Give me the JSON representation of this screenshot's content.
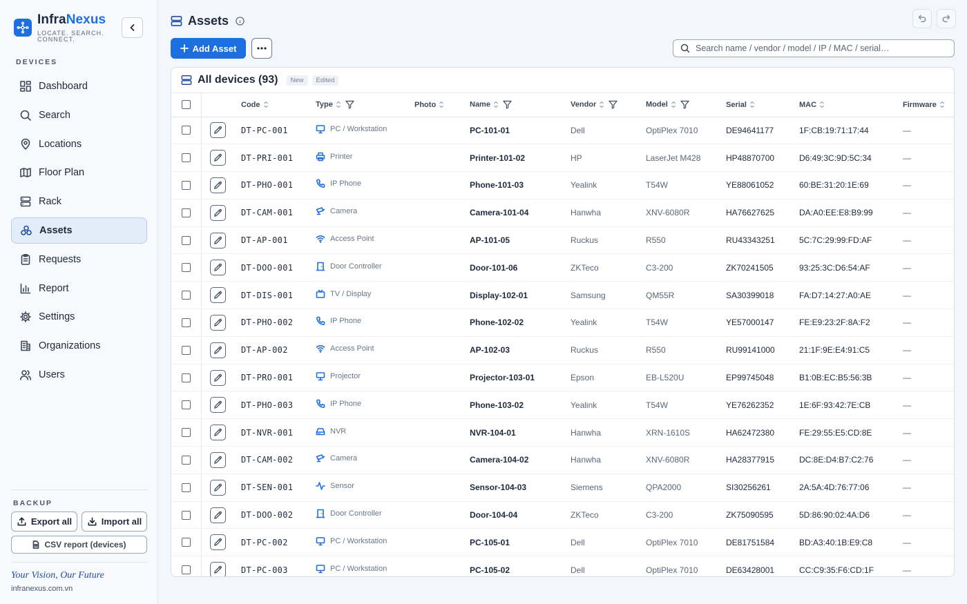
{
  "brand": {
    "name_a": "Infra",
    "name_b": "Nexus",
    "tagline": "LOCATE. SEARCH. CONNECT."
  },
  "sidebar": {
    "section_label": "DEVICES",
    "items": [
      {
        "label": "Dashboard",
        "icon": "dashboard-icon"
      },
      {
        "label": "Search",
        "icon": "search-icon"
      },
      {
        "label": "Locations",
        "icon": "map-pin-icon"
      },
      {
        "label": "Floor Plan",
        "icon": "map-icon"
      },
      {
        "label": "Rack",
        "icon": "server-icon"
      },
      {
        "label": "Assets",
        "icon": "boxes-icon",
        "active": true
      },
      {
        "label": "Requests",
        "icon": "clipboard-icon"
      },
      {
        "label": "Report",
        "icon": "bar-chart-icon"
      },
      {
        "label": "Settings",
        "icon": "gear-icon"
      },
      {
        "label": "Organizations",
        "icon": "building-icon"
      },
      {
        "label": "Users",
        "icon": "users-icon"
      }
    ],
    "backup_label": "BACKUP",
    "export_label": "Export all",
    "import_label": "Import all",
    "csv_label": "CSV report (devices)",
    "slogan": "Your Vision, Our Future",
    "site": "infranexus.com.vn"
  },
  "header": {
    "title": "Assets",
    "add_label": "Add Asset",
    "search_placeholder": "Search name / vendor / model / IP / MAC / serial…"
  },
  "table": {
    "title": "All devices (93)",
    "tag_new": "New",
    "tag_edited": "Edited",
    "columns": {
      "code": "Code",
      "type": "Type",
      "photo": "Photo",
      "name": "Name",
      "vendor": "Vendor",
      "model": "Model",
      "serial": "Serial",
      "mac": "MAC",
      "firmware": "Firmware"
    },
    "rows": [
      {
        "code": "DT-PC-001",
        "type": "PC / Workstation",
        "icon": "monitor-icon",
        "name": "PC-101-01",
        "vendor": "Dell",
        "model": "OptiPlex 7010",
        "serial": "DE94641177",
        "mac": "1F:CB:19:71:17:44",
        "firmware": "—"
      },
      {
        "code": "DT-PRI-001",
        "type": "Printer",
        "icon": "printer-icon",
        "name": "Printer-101-02",
        "vendor": "HP",
        "model": "LaserJet M428",
        "serial": "HP48870700",
        "mac": "D6:49:3C:9D:5C:34",
        "firmware": "—"
      },
      {
        "code": "DT-PHO-001",
        "type": "IP Phone",
        "icon": "phone-icon",
        "name": "Phone-101-03",
        "vendor": "Yealink",
        "model": "T54W",
        "serial": "YE88061052",
        "mac": "60:BE:31:20:1E:69",
        "firmware": "—"
      },
      {
        "code": "DT-CAM-001",
        "type": "Camera",
        "icon": "cctv-icon",
        "name": "Camera-101-04",
        "vendor": "Hanwha",
        "model": "XNV-6080R",
        "serial": "HA76627625",
        "mac": "DA:A0:EE:E8:B9:99",
        "firmware": "—"
      },
      {
        "code": "DT-AP-001",
        "type": "Access Point",
        "icon": "wifi-icon",
        "name": "AP-101-05",
        "vendor": "Ruckus",
        "model": "R550",
        "serial": "RU43343251",
        "mac": "5C:7C:29:99:FD:AF",
        "firmware": "—"
      },
      {
        "code": "DT-DOO-001",
        "type": "Door Controller",
        "icon": "door-icon",
        "name": "Door-101-06",
        "vendor": "ZKTeco",
        "model": "C3-200",
        "serial": "ZK70241505",
        "mac": "93:25:3C:D6:54:AF",
        "firmware": "—"
      },
      {
        "code": "DT-DIS-001",
        "type": "TV / Display",
        "icon": "tv-icon",
        "name": "Display-102-01",
        "vendor": "Samsung",
        "model": "QM55R",
        "serial": "SA30399018",
        "mac": "FA:D7:14:27:A0:AE",
        "firmware": "—"
      },
      {
        "code": "DT-PHO-002",
        "type": "IP Phone",
        "icon": "phone-icon",
        "name": "Phone-102-02",
        "vendor": "Yealink",
        "model": "T54W",
        "serial": "YE57000147",
        "mac": "FE:E9:23:2F:8A:F2",
        "firmware": "—"
      },
      {
        "code": "DT-AP-002",
        "type": "Access Point",
        "icon": "wifi-icon",
        "name": "AP-102-03",
        "vendor": "Ruckus",
        "model": "R550",
        "serial": "RU99141000",
        "mac": "21:1F:9E:E4:91:C5",
        "firmware": "—"
      },
      {
        "code": "DT-PRO-001",
        "type": "Projector",
        "icon": "projector-icon",
        "name": "Projector-103-01",
        "vendor": "Epson",
        "model": "EB-L520U",
        "serial": "EP99745048",
        "mac": "B1:0B:EC:B5:56:3B",
        "firmware": "—"
      },
      {
        "code": "DT-PHO-003",
        "type": "IP Phone",
        "icon": "phone-icon",
        "name": "Phone-103-02",
        "vendor": "Yealink",
        "model": "T54W",
        "serial": "YE76262352",
        "mac": "1E:6F:93:42:7E:CB",
        "firmware": "—"
      },
      {
        "code": "DT-NVR-001",
        "type": "NVR",
        "icon": "hard-drive-icon",
        "name": "NVR-104-01",
        "vendor": "Hanwha",
        "model": "XRN-1610S",
        "serial": "HA62472380",
        "mac": "FE:29:55:E5:CD:8E",
        "firmware": "—"
      },
      {
        "code": "DT-CAM-002",
        "type": "Camera",
        "icon": "cctv-icon",
        "name": "Camera-104-02",
        "vendor": "Hanwha",
        "model": "XNV-6080R",
        "serial": "HA28377915",
        "mac": "DC:8E:D4:B7:C2:76",
        "firmware": "—"
      },
      {
        "code": "DT-SEN-001",
        "type": "Sensor",
        "icon": "activity-icon",
        "name": "Sensor-104-03",
        "vendor": "Siemens",
        "model": "QPA2000",
        "serial": "SI30256261",
        "mac": "2A:5A:4D:76:77:06",
        "firmware": "—"
      },
      {
        "code": "DT-DOO-002",
        "type": "Door Controller",
        "icon": "door-icon",
        "name": "Door-104-04",
        "vendor": "ZKTeco",
        "model": "C3-200",
        "serial": "ZK75090595",
        "mac": "5D:86:90:02:4A:D6",
        "firmware": "—"
      },
      {
        "code": "DT-PC-002",
        "type": "PC / Workstation",
        "icon": "monitor-icon",
        "name": "PC-105-01",
        "vendor": "Dell",
        "model": "OptiPlex 7010",
        "serial": "DE81751584",
        "mac": "BD:A3:40:1B:E9:C8",
        "firmware": "—"
      },
      {
        "code": "DT-PC-003",
        "type": "PC / Workstation",
        "icon": "monitor-icon",
        "name": "PC-105-02",
        "vendor": "Dell",
        "model": "OptiPlex 7010",
        "serial": "DE63428001",
        "mac": "CC:C9:35:F6:CD:1F",
        "firmware": "—"
      }
    ]
  },
  "colors": {
    "accent": "#1d6fe0",
    "active_bg": "#e3ecf9"
  }
}
